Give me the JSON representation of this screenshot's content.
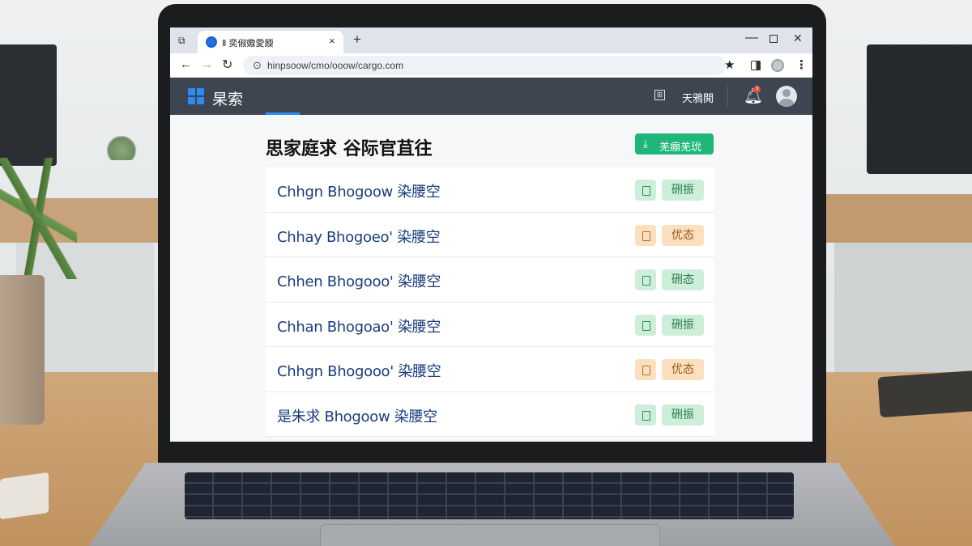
{
  "browser": {
    "tab_title": "Ⅱ 奕俶嫐愛餪",
    "tab_close": "×",
    "new_tab": "+",
    "url": "hinpsoow/cmo/ooow/cargo.com",
    "icons": [
      "tab-switch-icon",
      "favicon-icon",
      "back-icon",
      "forward-icon",
      "reload-icon",
      "site-info-icon",
      "star-icon",
      "sidepanel-icon",
      "extension-icon",
      "menu-icon",
      "minimize-icon",
      "maximize-icon",
      "close-icon"
    ]
  },
  "app": {
    "title": "杲索",
    "header_link": "天鴉閧",
    "notification_count": "3",
    "accent_color": "#2b8cf0",
    "header_bg": "#3d4550"
  },
  "main": {
    "page_title": "思家庭求 谷际官苴往",
    "export_label": "羌痭羌玧",
    "export_color": "#1fb67a",
    "rows": [
      {
        "name": "Chhgn Bhogoow 染腰空",
        "status": "硎振",
        "tone": "green"
      },
      {
        "name": "Chhay Bhogoeo' 染腰空",
        "status": "优态",
        "tone": "orange"
      },
      {
        "name": "Chhen Bhogooo' 染腰空",
        "status": "硎态",
        "tone": "green"
      },
      {
        "name": "Chhan Bhogoao' 染腰空",
        "status": "硎振",
        "tone": "green"
      },
      {
        "name": "Chhgn Bhogooo' 染腰空",
        "status": "优态",
        "tone": "orange"
      },
      {
        "name": "是朱求 Bhogoow 染腰空",
        "status": "硎振",
        "tone": "green"
      }
    ]
  }
}
